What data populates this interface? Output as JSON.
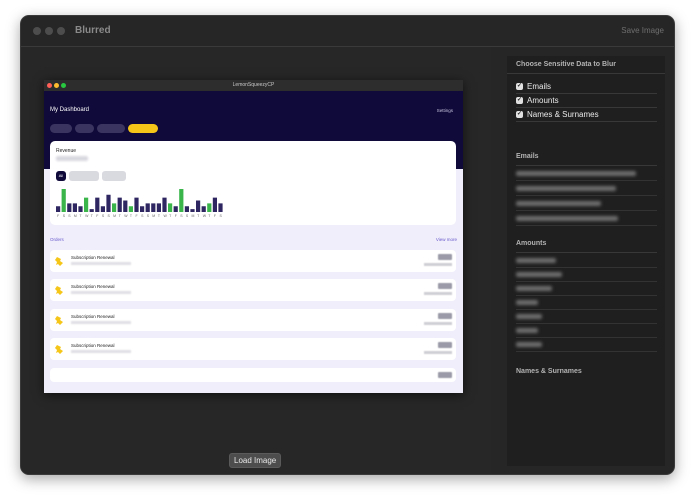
{
  "window": {
    "title": "Blurred",
    "save_label": "Save Image",
    "load_label": "Load Image"
  },
  "preview": {
    "app_title": "LemonSqueezyCP",
    "dashboard_title": "My Dashboard",
    "settings_label": "Settings",
    "revenue_label": "Revenue",
    "filter_chip": "All",
    "orders_label": "Orders",
    "view_more_label": "View more",
    "orders": [
      {
        "title": "Subscription Renewal"
      },
      {
        "title": "Subscription Renewal"
      },
      {
        "title": "Subscription Renewal"
      },
      {
        "title": "Subscription Renewal"
      }
    ],
    "day_letters": [
      "F",
      "S",
      "S",
      "M",
      "T",
      "W",
      "T",
      "F",
      "S",
      "S",
      "M",
      "T",
      "W",
      "T",
      "F",
      "S",
      "S",
      "M",
      "T",
      "W",
      "T",
      "F",
      "S",
      "S",
      "M",
      "T",
      "W",
      "T",
      "F",
      "S"
    ]
  },
  "chart_data": {
    "type": "bar",
    "categories": [
      "F",
      "S",
      "S",
      "M",
      "T",
      "W",
      "T",
      "F",
      "S",
      "S",
      "M",
      "T",
      "W",
      "T",
      "F",
      "S",
      "S",
      "M",
      "T",
      "W",
      "T",
      "F",
      "S",
      "S",
      "M",
      "T",
      "W",
      "T",
      "F",
      "S"
    ],
    "values": [
      2,
      8,
      3,
      3,
      2,
      5,
      1,
      5,
      2,
      6,
      3,
      5,
      4,
      2,
      5,
      2,
      3,
      3,
      3,
      5,
      3,
      2,
      8,
      2,
      1,
      4,
      2,
      3,
      5,
      3
    ],
    "highlight_color": "#39b54a",
    "base_color": "#2d2660",
    "highlight_index": [
      1,
      5,
      10,
      13,
      20,
      22,
      27
    ]
  },
  "sidebar": {
    "choose_title": "Choose Sensitive Data to Blur",
    "options": [
      {
        "label": "Emails",
        "checked": true
      },
      {
        "label": "Amounts",
        "checked": true
      },
      {
        "label": "Names & Surnames",
        "checked": true
      }
    ],
    "emails_title": "Emails",
    "amounts_title": "Amounts",
    "names_title": "Names & Surnames"
  },
  "colors": {
    "window_bg": "#262626",
    "panel_bg": "#1f1f1f",
    "accent_yellow": "#f5c518",
    "dashboard_header": "#100a3a"
  }
}
